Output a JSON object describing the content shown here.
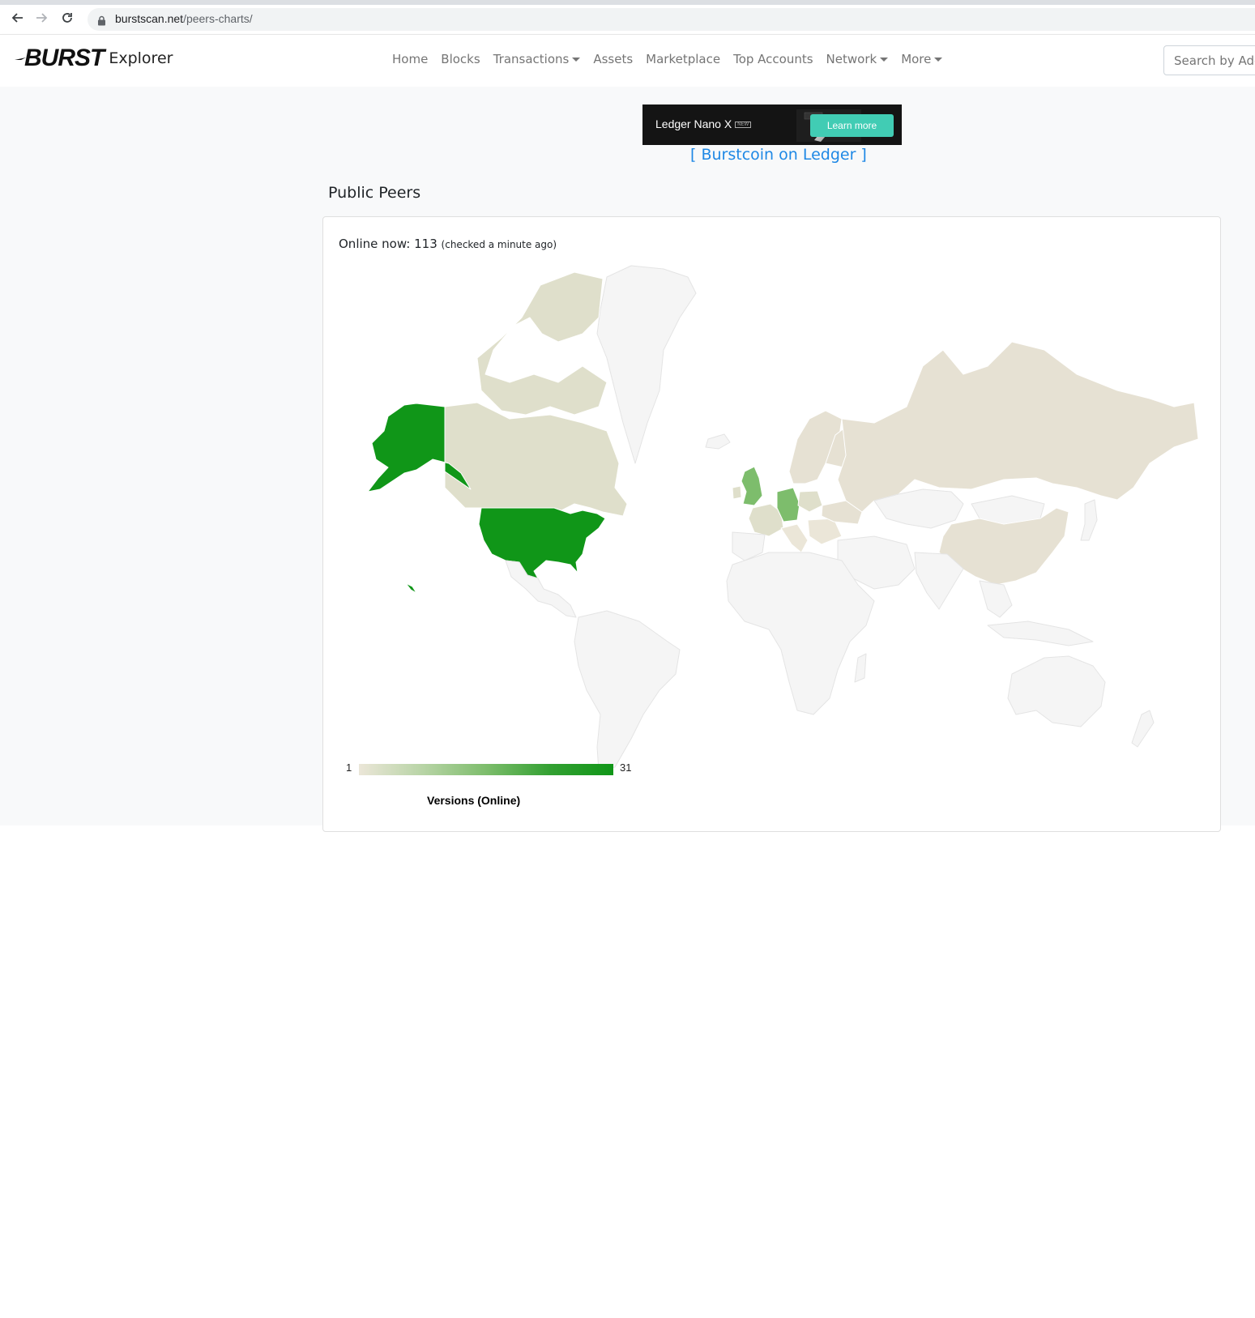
{
  "browser": {
    "url_host": "burstscan.net",
    "url_path": "/peers-charts/"
  },
  "navbar": {
    "brand_logo": "BURST",
    "brand_text": "Explorer",
    "items": [
      {
        "label": "Home",
        "dropdown": false
      },
      {
        "label": "Blocks",
        "dropdown": false
      },
      {
        "label": "Transactions",
        "dropdown": true
      },
      {
        "label": "Assets",
        "dropdown": false
      },
      {
        "label": "Marketplace",
        "dropdown": false
      },
      {
        "label": "Top Accounts",
        "dropdown": false
      },
      {
        "label": "Network",
        "dropdown": true
      },
      {
        "label": "More",
        "dropdown": true
      }
    ],
    "search_placeholder": "Search by Add"
  },
  "ad": {
    "product_prefix": "Ledger",
    "product_name": "Nano X",
    "new_badge": "NEW",
    "button_label": "Learn more",
    "link_text": "[ Burstcoin on Ledger ]"
  },
  "main": {
    "section_title": "Public Peers",
    "online_label": "Online now:",
    "online_count": "113",
    "online_checked": "(checked a minute ago)",
    "versions_title": "Versions (Online)"
  },
  "map_data": {
    "type": "geochart",
    "legend_min": "1",
    "legend_max": "31",
    "colors": {
      "low": "#ebe6d8",
      "high": "#109618",
      "no_data": "#f5f5f5"
    },
    "regions": [
      {
        "region": "United States",
        "level": "high"
      },
      {
        "region": "Germany",
        "level": "medium"
      },
      {
        "region": "United Kingdom",
        "level": "medium"
      },
      {
        "region": "Canada",
        "level": "low"
      },
      {
        "region": "Russia",
        "level": "low"
      },
      {
        "region": "China",
        "level": "low"
      },
      {
        "region": "France",
        "level": "low"
      },
      {
        "region": "Netherlands",
        "level": "low"
      },
      {
        "region": "Poland",
        "level": "low"
      },
      {
        "region": "Sweden",
        "level": "low"
      },
      {
        "region": "Finland",
        "level": "low"
      },
      {
        "region": "Norway",
        "level": "low"
      },
      {
        "region": "Ukraine",
        "level": "low"
      }
    ]
  }
}
